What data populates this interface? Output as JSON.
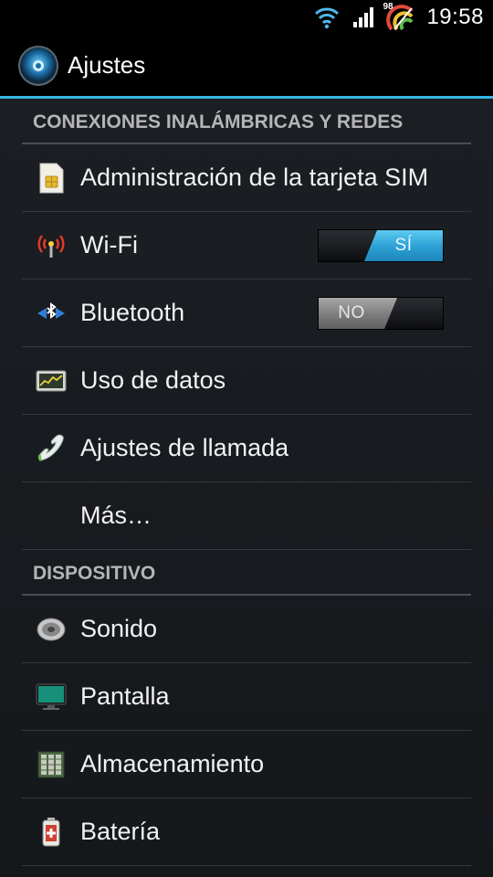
{
  "status_bar": {
    "time": "19:58",
    "battery_level": "98",
    "icons": [
      "wifi-icon",
      "signal-icon",
      "battery-icon"
    ]
  },
  "action_bar": {
    "title": "Ajustes",
    "icon": "settings-icon"
  },
  "sections": [
    {
      "header": "CONEXIONES INALÁMBRICAS Y REDES",
      "items": [
        {
          "label": "Administración de la tarjeta SIM",
          "icon": "sim-card-icon"
        },
        {
          "label": "Wi-Fi",
          "icon": "wifi-antenna-icon",
          "toggle": "SÍ"
        },
        {
          "label": "Bluetooth",
          "icon": "bluetooth-icon",
          "toggle": "NO"
        },
        {
          "label": "Uso de datos",
          "icon": "data-usage-icon"
        },
        {
          "label": "Ajustes de llamada",
          "icon": "phone-icon"
        },
        {
          "label": "Más…"
        }
      ]
    },
    {
      "header": "DISPOSITIVO",
      "items": [
        {
          "label": "Sonido",
          "icon": "speaker-icon"
        },
        {
          "label": "Pantalla",
          "icon": "display-icon"
        },
        {
          "label": "Almacenamiento",
          "icon": "storage-icon"
        },
        {
          "label": "Batería",
          "icon": "battery-settings-icon"
        }
      ]
    }
  ],
  "colors": {
    "accent": "#33b5e5",
    "background": "#1a1d21",
    "section_header": "#b5b5b5"
  }
}
